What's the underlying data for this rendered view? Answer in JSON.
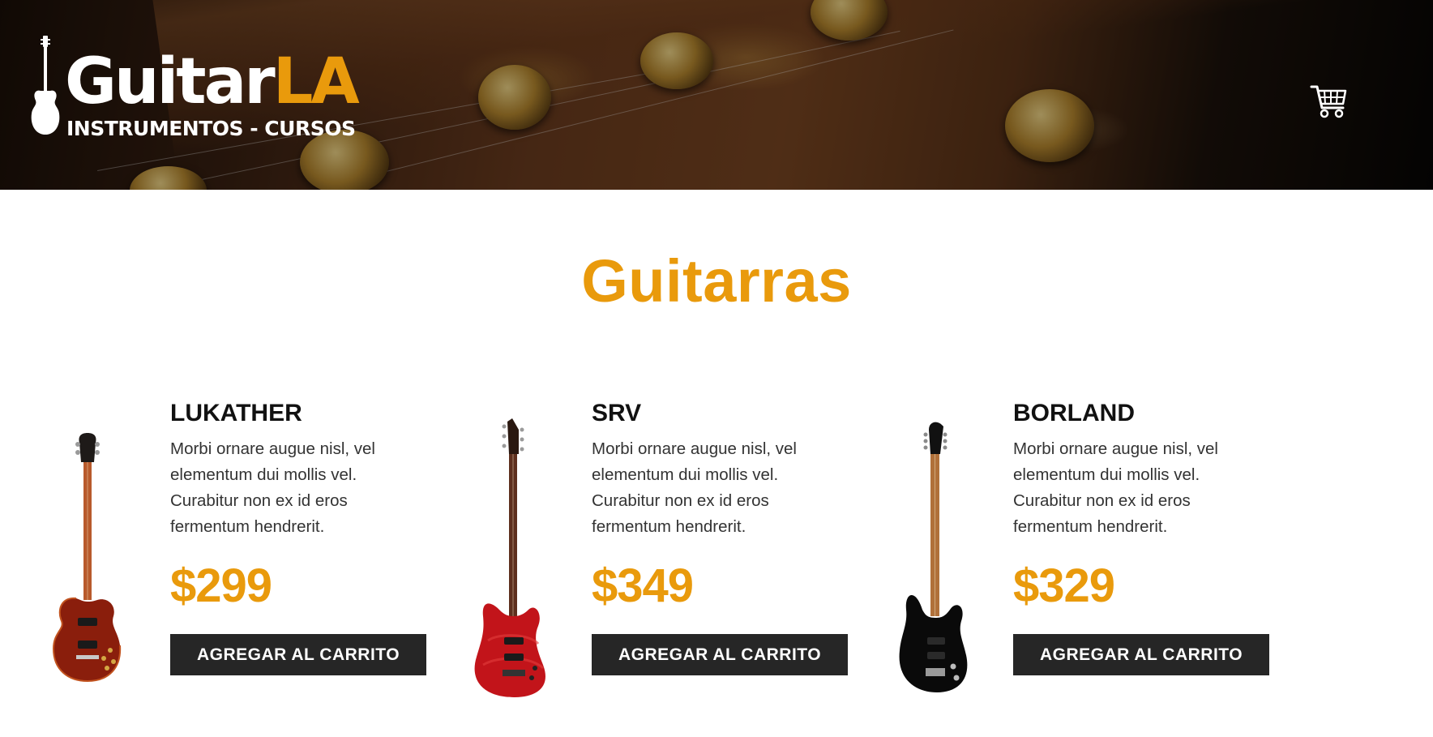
{
  "header": {
    "logo_title_white": "Guitar",
    "logo_title_orange": "LA",
    "logo_subtitle": "INSTRUMENTOS - CURSOS",
    "cart_icon": "shopping-cart-icon"
  },
  "main": {
    "title": "Guitarras",
    "products": [
      {
        "name": "LUKATHER",
        "description": "Morbi ornare augue nisl, vel elementum dui mollis vel. Curabitur non ex id eros fermentum hendrerit.",
        "price": "$299",
        "button_label": "AGREGAR AL CARRITO"
      },
      {
        "name": "SRV",
        "description": "Morbi ornare augue nisl, vel elementum dui mollis vel. Curabitur non ex id eros fermentum hendrerit.",
        "price": "$349",
        "button_label": "AGREGAR AL CARRITO"
      },
      {
        "name": "BORLAND",
        "description": "Morbi ornare augue nisl, vel elementum dui mollis vel. Curabitur non ex id eros fermentum hendrerit.",
        "price": "$329",
        "button_label": "AGREGAR AL CARRITO"
      }
    ]
  },
  "colors": {
    "accent": "#e99a0c",
    "button_bg": "#262626",
    "text": "#111111"
  }
}
